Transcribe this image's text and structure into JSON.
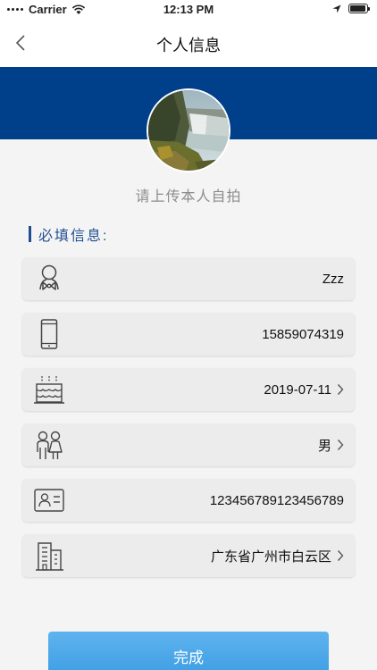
{
  "status_bar": {
    "carrier": "Carrier",
    "time": "12:13 PM",
    "battery_level": 0.95
  },
  "nav": {
    "title": "个人信息",
    "back_icon": "chevron-left-icon"
  },
  "avatar": {
    "upload_hint": "请上传本人自拍"
  },
  "section": {
    "title": "必填信息:"
  },
  "fields": [
    {
      "icon": "person-bowtie-icon",
      "value": "Zzz",
      "has_chevron": false
    },
    {
      "icon": "mobile-phone-icon",
      "value": "15859074319",
      "has_chevron": false
    },
    {
      "icon": "birthday-cake-icon",
      "value": "2019-07-11",
      "has_chevron": true
    },
    {
      "icon": "gender-people-icon",
      "value": "男",
      "has_chevron": true
    },
    {
      "icon": "id-card-icon",
      "value": "123456789123456789",
      "has_chevron": false
    },
    {
      "icon": "building-icon",
      "value": "广东省广州市白云区",
      "has_chevron": true
    }
  ],
  "submit": {
    "label": "完成"
  },
  "colors": {
    "brand_blue": "#003f8a",
    "section_blue": "#1f4f91",
    "button_blue": "#4aa8ea"
  }
}
